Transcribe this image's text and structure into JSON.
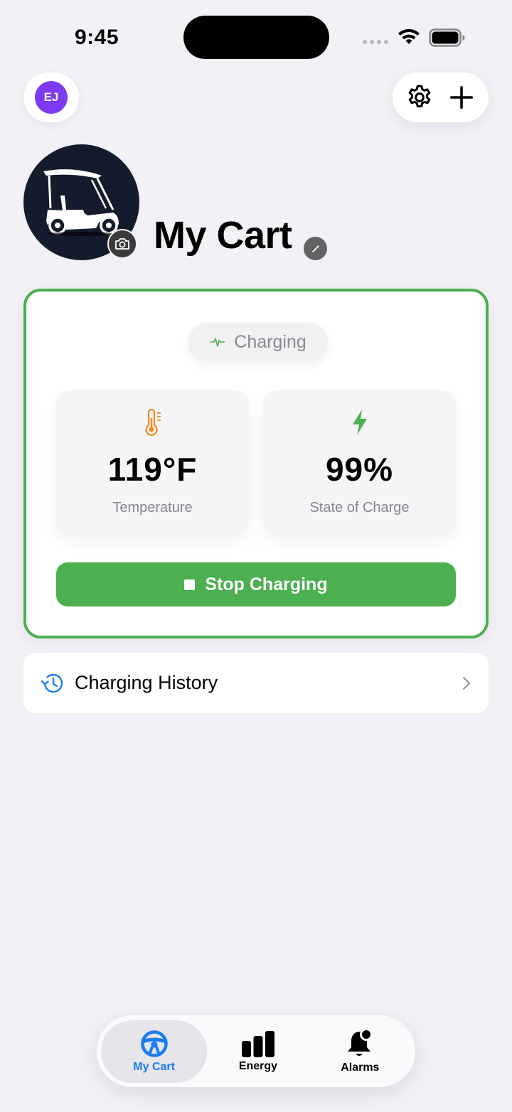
{
  "status_bar": {
    "time": "9:45"
  },
  "header": {
    "avatar_initials": "EJ"
  },
  "cart": {
    "name": "My Cart"
  },
  "status_card": {
    "status_label": "Charging",
    "temperature": {
      "value": "119°F",
      "label": "Temperature"
    },
    "state_of_charge": {
      "value": "99%",
      "label": "State of Charge"
    },
    "stop_button_label": "Stop Charging"
  },
  "history": {
    "label": "Charging History"
  },
  "tabs": [
    {
      "label": "My Cart",
      "icon": "steering-wheel-icon",
      "active": true
    },
    {
      "label": "Energy",
      "icon": "bar-chart-icon",
      "active": false
    },
    {
      "label": "Alarms",
      "icon": "bell-badge-icon",
      "active": false
    }
  ],
  "colors": {
    "accent_green": "#4caf50",
    "accent_blue": "#1a7cf2",
    "avatar_purple": "#7e3af2",
    "temperature_orange": "#f08a24",
    "charge_green": "#4caf50"
  }
}
